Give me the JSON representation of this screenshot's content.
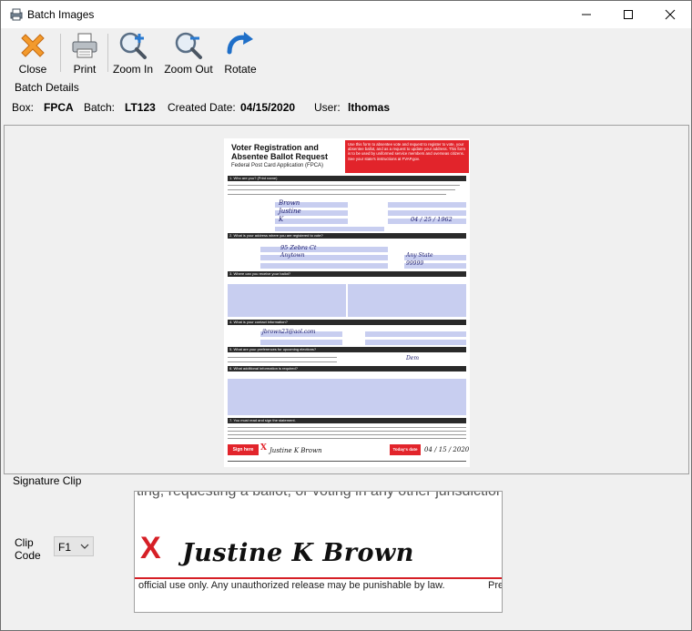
{
  "window": {
    "title": "Batch Images"
  },
  "toolbar": {
    "close": "Close",
    "print": "Print",
    "zoom_in": "Zoom In",
    "zoom_out": "Zoom Out",
    "rotate": "Rotate"
  },
  "batch_details": {
    "group_title": "Batch Details",
    "box_label": "Box:",
    "box_value": "FPCA",
    "batch_label": "Batch:",
    "batch_value": "LT123",
    "created_label": "Created Date:",
    "created_value": "04/15/2020",
    "user_label": "User:",
    "user_value": "lthomas"
  },
  "document": {
    "title_line1": "Voter Registration and",
    "title_line2": "Absentee Ballot Request",
    "subtitle": "Federal Post Card Application (FPCA)",
    "red_notice": "Use this form to absentee vote and request to register to vote, your absentee ballot, and as a request to update your address. This form is to be used by uniformed service members and overseas citizens. See your state's instructions at FVAP.gov.",
    "sections": [
      "1. Who are you? (Print name)",
      "2. What is your address where you are registered to vote?",
      "3. Where can you receive your ballot?",
      "4. What is your contact information?",
      "5. What are your preferences for upcoming elections?",
      "6. What additional information is required?",
      "7. You must read and sign the statement."
    ],
    "last_name": "Brown",
    "first_name": "Justine",
    "middle_name": "K",
    "dob": "04 / 25 / 1962",
    "street": "95 Zebra Ct",
    "city": "Anytown",
    "state": "Any State",
    "zip": "99999",
    "email": "jbrown23@aol.com",
    "party": "Dem",
    "sign_here": "Sign here",
    "signature": "Justine K Brown",
    "today_label": "Today's date",
    "date_signed": "04 / 15 / 2020"
  },
  "signature_clip": {
    "group_title": "Signature Clip",
    "clip_code_label_1": "Clip",
    "clip_code_label_2": "Code",
    "clip_code_value": "F1",
    "top_text": "ting, requesting a ballot, or voting in any other jurisdiction i",
    "x_mark": "X",
    "signature": "Justine K Brown",
    "bottom_text": "official use only. Any unauthorized release may be punishable by law.",
    "bottom_right": "Pre"
  },
  "colors": {
    "accent_red": "#d61f26",
    "form_field_blue": "#c8cef0",
    "window_bg": "#f0f0f0"
  }
}
